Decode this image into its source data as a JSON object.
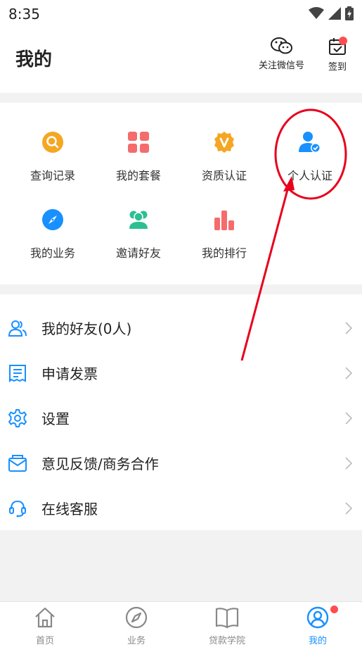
{
  "status_bar": {
    "time": "8:35",
    "icons": [
      "wifi-icon",
      "signal-icon",
      "battery-icon"
    ]
  },
  "header": {
    "title": "我的",
    "wechat_label": "关注微信号",
    "checkin_label": "签到"
  },
  "grid": {
    "items": [
      {
        "label": "查询记录",
        "icon": "search-icon",
        "color": "#f5a623"
      },
      {
        "label": "我的套餐",
        "icon": "package-icon",
        "color": "#f56c6c"
      },
      {
        "label": "资质认证",
        "icon": "qualification-badge-icon",
        "color": "#f5a623"
      },
      {
        "label": "个人认证",
        "icon": "user-verified-icon",
        "color": "#1890ff"
      },
      {
        "label": "我的业务",
        "icon": "compass-icon",
        "color": "#1890ff"
      },
      {
        "label": "邀请好友",
        "icon": "invite-friends-icon",
        "color": "#2cbf93"
      },
      {
        "label": "我的排行",
        "icon": "ranking-icon",
        "color": "#f56c6c"
      }
    ]
  },
  "list": {
    "items": [
      {
        "label": "我的好友(0人)",
        "icon": "friends-icon"
      },
      {
        "label": "申请发票",
        "icon": "invoice-icon"
      },
      {
        "label": "设置",
        "icon": "settings-gear-icon"
      },
      {
        "label": "意见反馈/商务合作",
        "icon": "feedback-mail-icon"
      },
      {
        "label": "在线客服",
        "icon": "customer-service-icon"
      }
    ]
  },
  "tabbar": {
    "tabs": [
      {
        "label": "首页",
        "icon": "home-icon"
      },
      {
        "label": "业务",
        "icon": "compass-icon"
      },
      {
        "label": "贷款学院",
        "icon": "book-icon"
      },
      {
        "label": "我的",
        "icon": "user-circle-icon",
        "active": true
      }
    ]
  },
  "colors": {
    "accent": "#1890ff",
    "badge": "#ff4d4f",
    "annotation": "#e8001c"
  }
}
